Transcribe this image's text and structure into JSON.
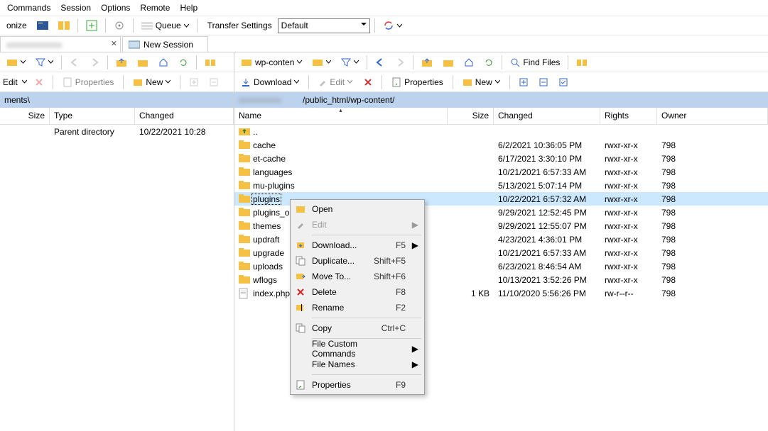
{
  "menubar": [
    "Commands",
    "Session",
    "Options",
    "Remote",
    "Help"
  ],
  "toolbar_top": {
    "left_button_partial": "onize",
    "queue_label": "Queue",
    "transfer_settings_label": "Transfer Settings",
    "transfer_settings_value": "Default"
  },
  "tabs": {
    "active_label": "",
    "new_session_label": "New Session"
  },
  "left_pane": {
    "nav_combo": "",
    "edit_label": "Edit",
    "properties_label": "Properties",
    "new_label": "New",
    "path_partial": "ments\\",
    "columns": {
      "size": "Size",
      "type": "Type",
      "changed": "Changed"
    },
    "rows": [
      {
        "icon": "up",
        "type": "Parent directory",
        "changed": "10/22/2021 10:28"
      }
    ]
  },
  "right_pane": {
    "nav_combo": "wp-conten",
    "find_label": "Find Files",
    "download_label": "Download",
    "edit_label": "Edit",
    "properties_label": "Properties",
    "new_label": "New",
    "path_prefix_hidden": "[hostname]",
    "path": "/public_html/wp-content/",
    "columns": {
      "name": "Name",
      "size": "Size",
      "changed": "Changed",
      "rights": "Rights",
      "owner": "Owner"
    },
    "rows": [
      {
        "icon": "up",
        "name": "..",
        "size": "",
        "changed": "",
        "rights": "",
        "owner": ""
      },
      {
        "icon": "folder",
        "name": "cache",
        "size": "",
        "changed": "6/2/2021 10:36:05 PM",
        "rights": "rwxr-xr-x",
        "owner": "798"
      },
      {
        "icon": "folder",
        "name": "et-cache",
        "size": "",
        "changed": "6/17/2021 3:30:10 PM",
        "rights": "rwxr-xr-x",
        "owner": "798"
      },
      {
        "icon": "folder",
        "name": "languages",
        "size": "",
        "changed": "10/21/2021 6:57:33 AM",
        "rights": "rwxr-xr-x",
        "owner": "798"
      },
      {
        "icon": "folder",
        "name": "mu-plugins",
        "size": "",
        "changed": "5/13/2021 5:07:14 PM",
        "rights": "rwxr-xr-x",
        "owner": "798"
      },
      {
        "icon": "folder",
        "name": "plugins",
        "size": "",
        "changed": "10/22/2021 6:57:32 AM",
        "rights": "rwxr-xr-x",
        "owner": "798",
        "selected": true
      },
      {
        "icon": "folder",
        "name": "plugins_old",
        "size": "",
        "changed": "9/29/2021 12:52:45 PM",
        "rights": "rwxr-xr-x",
        "owner": "798"
      },
      {
        "icon": "folder",
        "name": "themes",
        "size": "",
        "changed": "9/29/2021 12:55:07 PM",
        "rights": "rwxr-xr-x",
        "owner": "798"
      },
      {
        "icon": "folder",
        "name": "updraft",
        "size": "",
        "changed": "4/23/2021 4:36:01 PM",
        "rights": "rwxr-xr-x",
        "owner": "798"
      },
      {
        "icon": "folder",
        "name": "upgrade",
        "size": "",
        "changed": "10/21/2021 6:57:33 AM",
        "rights": "rwxr-xr-x",
        "owner": "798"
      },
      {
        "icon": "folder",
        "name": "uploads",
        "size": "",
        "changed": "6/23/2021 8:46:54 AM",
        "rights": "rwxr-xr-x",
        "owner": "798"
      },
      {
        "icon": "folder",
        "name": "wflogs",
        "size": "",
        "changed": "10/13/2021 3:52:26 PM",
        "rights": "rwxr-xr-x",
        "owner": "798"
      },
      {
        "icon": "file",
        "name": "index.php",
        "size": "1 KB",
        "changed": "11/10/2020 5:56:26 PM",
        "rights": "rw-r--r--",
        "owner": "798"
      }
    ]
  },
  "context_menu": [
    {
      "icon": "open",
      "label": "Open",
      "shortcut": "",
      "sub": false
    },
    {
      "icon": "edit",
      "label": "Edit",
      "shortcut": "",
      "sub": true,
      "disabled": true
    },
    {
      "sep": true
    },
    {
      "icon": "download",
      "label": "Download...",
      "shortcut": "F5",
      "sub": true
    },
    {
      "icon": "duplicate",
      "label": "Duplicate...",
      "shortcut": "Shift+F5",
      "sub": false
    },
    {
      "icon": "move",
      "label": "Move To...",
      "shortcut": "Shift+F6",
      "sub": false
    },
    {
      "icon": "delete",
      "label": "Delete",
      "shortcut": "F8",
      "sub": false
    },
    {
      "icon": "rename",
      "label": "Rename",
      "shortcut": "F2",
      "sub": false
    },
    {
      "sep": true
    },
    {
      "icon": "copy",
      "label": "Copy",
      "shortcut": "Ctrl+C",
      "sub": false
    },
    {
      "sep": true
    },
    {
      "icon": "",
      "label": "File Custom Commands",
      "shortcut": "",
      "sub": true
    },
    {
      "icon": "",
      "label": "File Names",
      "shortcut": "",
      "sub": true
    },
    {
      "sep": true
    },
    {
      "icon": "properties",
      "label": "Properties",
      "shortcut": "F9",
      "sub": false
    }
  ],
  "icons": {
    "monitor": "#2b5797",
    "two-monitors": "#2b5797"
  }
}
